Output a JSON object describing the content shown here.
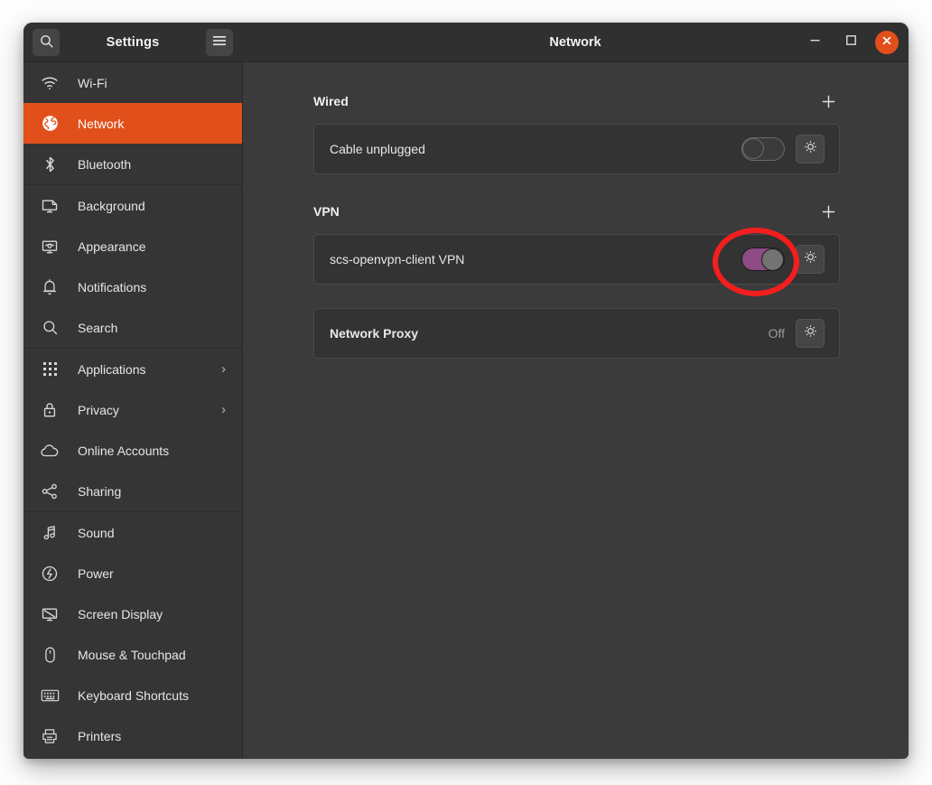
{
  "window": {
    "title": "Network",
    "sidebar_header_title": "Settings",
    "search_icon": "search-icon",
    "menu_icon": "hamburger-menu-icon",
    "minimize_label": "–",
    "maximize_label": "□",
    "close_label": "✕"
  },
  "colors": {
    "accent": "#e1501b",
    "window_bg": "#3b3b3b",
    "sidebar_bg": "#353535",
    "headerbar_bg": "#303030",
    "card_bg": "#333333",
    "switch_on": "#8e4b85",
    "annotation": "#f41e1e"
  },
  "sidebar": {
    "items": [
      {
        "label": "Wi-Fi",
        "icon": "wifi-icon",
        "selected": false,
        "chevron": false,
        "separator_after": false
      },
      {
        "label": "Network",
        "icon": "globe-icon",
        "selected": true,
        "chevron": false,
        "separator_after": false
      },
      {
        "label": "Bluetooth",
        "icon": "bluetooth-icon",
        "selected": false,
        "chevron": false,
        "separator_after": true
      },
      {
        "label": "Background",
        "icon": "background-monitor-icon",
        "selected": false,
        "chevron": false,
        "separator_after": false
      },
      {
        "label": "Appearance",
        "icon": "appearance-icon",
        "selected": false,
        "chevron": false,
        "separator_after": false
      },
      {
        "label": "Notifications",
        "icon": "bell-icon",
        "selected": false,
        "chevron": false,
        "separator_after": false
      },
      {
        "label": "Search",
        "icon": "search-icon",
        "selected": false,
        "chevron": false,
        "separator_after": true
      },
      {
        "label": "Applications",
        "icon": "apps-grid-icon",
        "selected": false,
        "chevron": true,
        "separator_after": false
      },
      {
        "label": "Privacy",
        "icon": "lock-icon",
        "selected": false,
        "chevron": true,
        "separator_after": false
      },
      {
        "label": "Online Accounts",
        "icon": "cloud-icon",
        "selected": false,
        "chevron": false,
        "separator_after": false
      },
      {
        "label": "Sharing",
        "icon": "share-nodes-icon",
        "selected": false,
        "chevron": false,
        "separator_after": true
      },
      {
        "label": "Sound",
        "icon": "music-note-icon",
        "selected": false,
        "chevron": false,
        "separator_after": false
      },
      {
        "label": "Power",
        "icon": "power-icon",
        "selected": false,
        "chevron": false,
        "separator_after": false
      },
      {
        "label": "Screen Display",
        "icon": "display-icon",
        "selected": false,
        "chevron": false,
        "separator_after": false
      },
      {
        "label": "Mouse & Touchpad",
        "icon": "mouse-icon",
        "selected": false,
        "chevron": false,
        "separator_after": false
      },
      {
        "label": "Keyboard Shortcuts",
        "icon": "keyboard-icon",
        "selected": false,
        "chevron": false,
        "separator_after": false
      },
      {
        "label": "Printers",
        "icon": "printer-icon",
        "selected": false,
        "chevron": false,
        "separator_after": false
      }
    ]
  },
  "main": {
    "sections": [
      {
        "title": "Wired",
        "add_label": "+",
        "rows": [
          {
            "label": "Cable unplugged",
            "bold": false,
            "switch": "off",
            "status_text": "",
            "gear": true
          }
        ]
      },
      {
        "title": "VPN",
        "add_label": "+",
        "rows": [
          {
            "label": "scs-openvpn-client VPN",
            "bold": false,
            "switch": "on",
            "status_text": "",
            "gear": true
          }
        ]
      }
    ],
    "proxy": {
      "label": "Network Proxy",
      "status_text": "Off",
      "gear_icon": "gear-icon"
    }
  },
  "annotation": {
    "shape": "ellipse",
    "target": "vpn-toggle-switch",
    "color": "#f41e1e"
  }
}
